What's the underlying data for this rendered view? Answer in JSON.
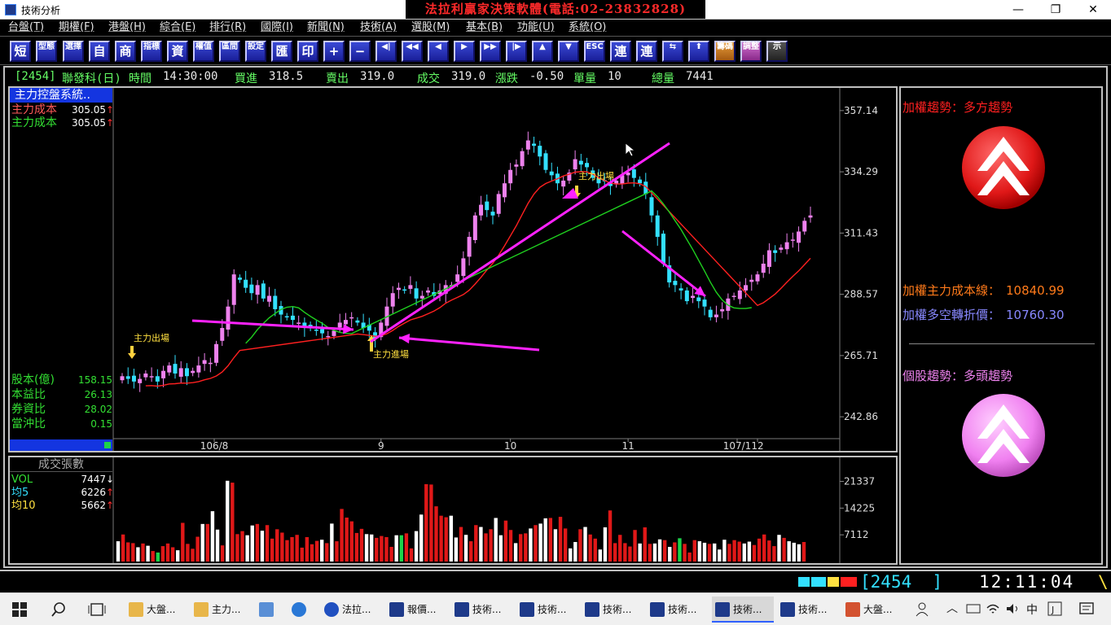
{
  "window": {
    "title": "技術分析",
    "banner": "法拉利贏家決策軟體(電話:02-23832828)",
    "minimize": "—",
    "restore": "❐",
    "close": "✕"
  },
  "menu": [
    "台盤(T)",
    "期權(F)",
    "港盤(H)",
    "綜合(E)",
    "排行(R)",
    "國際(I)",
    "新聞(N)",
    "技術(A)",
    "選股(M)",
    "基本(B)",
    "功能(U)",
    "系統(O)"
  ],
  "toolbar": [
    "短",
    "型態",
    "選擇",
    "自",
    "商",
    "指標",
    "資",
    "權值",
    "區間",
    "設定",
    "匯",
    "印",
    "+",
    "−",
    "◀|",
    "◀◀",
    "◀",
    "▶",
    "▶▶",
    "|▶",
    "▲",
    "▼",
    "ESC",
    "連",
    "連",
    "⇆",
    "⬆",
    "籌碼",
    "調整",
    "示"
  ],
  "quote": {
    "code": "[2454]",
    "name": "聯發科(日)",
    "time_label": "時間",
    "time": "14:30:00",
    "bid_label": "買進",
    "bid": "318.5",
    "ask_label": "賣出",
    "ask": "319.0",
    "deal_label": "成交",
    "deal": "319.0",
    "chg_label": "漲跌",
    "chg": "-0.50",
    "vol_label": "單量",
    "vol": "10",
    "total_label": "總量",
    "total": "7441"
  },
  "left_panel": {
    "system_button": "主力控盤系統..",
    "cost1_label": "主力成本",
    "cost1": "305.05",
    "cost2_label": "主力成本",
    "cost2": "305.05",
    "arrow": "↑",
    "fundamentals": [
      {
        "label": "股本(億)",
        "value": "158.15"
      },
      {
        "label": "本益比",
        "value": "26.13"
      },
      {
        "label": "券資比",
        "value": "28.02"
      },
      {
        "label": "當沖比",
        "value": "0.15"
      }
    ]
  },
  "vol_panel": {
    "title": "成交張數",
    "rows": [
      {
        "label": "VOL",
        "value": "7447",
        "arrow": "↓"
      },
      {
        "label": "均5",
        "value": "6226",
        "arrow": "↑"
      },
      {
        "label": "均10",
        "value": "5662",
        "arrow": "↑"
      }
    ]
  },
  "annotations": {
    "exit1": "主力出場",
    "entry": "主力進場",
    "exit2": "主力出場"
  },
  "right_panel": {
    "index_trend": "加權趨勢：多方趨勢",
    "cost_line_label": "加權主力成本線：",
    "cost_line_value": "10840.99",
    "pivot_label": "加權多空轉折價：",
    "pivot_value": "10760.30",
    "stock_trend": "個股趨勢：多頭趨勢"
  },
  "status": {
    "code": "[2454  ]",
    "clock": "12:11:04",
    "spinner": "\\"
  },
  "taskbar": [
    {
      "label": "大盤...",
      "icon": "folder-icon"
    },
    {
      "label": "主力...",
      "icon": "folder-icon"
    },
    {
      "label": "",
      "icon": "computer-icon"
    },
    {
      "label": "",
      "icon": "ie-icon"
    },
    {
      "label": "法拉...",
      "icon": "app-icon"
    },
    {
      "label": "報價...",
      "icon": "chart-app-icon"
    },
    {
      "label": "技術...",
      "icon": "chart-app-icon"
    },
    {
      "label": "技術...",
      "icon": "chart-app-icon"
    },
    {
      "label": "技術...",
      "icon": "chart-app-icon"
    },
    {
      "label": "技術...",
      "icon": "chart-app-icon"
    },
    {
      "label": "技術...",
      "icon": "chart-app-icon"
    },
    {
      "label": "技術...",
      "icon": "chart-app-icon"
    },
    {
      "label": "大盤...",
      "icon": "powerpoint-icon"
    }
  ],
  "tray": {
    "ime": "中"
  },
  "chart_data": [
    {
      "type": "candlestick",
      "title": "",
      "ylabel": "",
      "ylim": [
        235,
        365
      ],
      "y_ticks": [
        357.14,
        334.29,
        311.43,
        288.57,
        265.71,
        242.86
      ],
      "x_ticks": [
        "106/8",
        "9",
        "10",
        "11",
        "12",
        "107/1"
      ],
      "colors": {
        "up": "#ee82ee",
        "down": "#33e0ff",
        "cost_line_red": "#ff2020",
        "cost_line_green": "#1fd11f",
        "annotation_arrow": "#ff22ff"
      },
      "close_series": [
        258,
        257,
        256,
        257,
        259,
        258,
        256,
        260,
        262,
        259,
        261,
        258,
        260,
        262,
        264,
        263,
        270,
        276,
        284,
        296,
        294,
        291,
        289,
        292,
        287,
        288,
        283,
        281,
        280,
        279,
        278,
        276,
        276,
        275,
        274,
        273,
        275,
        278,
        279,
        280,
        278,
        276,
        275,
        272,
        278,
        284,
        289,
        291,
        290,
        292,
        287,
        288,
        290,
        288,
        290,
        292,
        292,
        296,
        302,
        310,
        318,
        322,
        320,
        318,
        326,
        330,
        335,
        337,
        342,
        346,
        344,
        340,
        335,
        333,
        330,
        331,
        334,
        339,
        337,
        336,
        332,
        330,
        331,
        329,
        331,
        333,
        334,
        332,
        330,
        326,
        318,
        310,
        300,
        293,
        292,
        290,
        286,
        288,
        286,
        284,
        280,
        281,
        283,
        287,
        288,
        290,
        292,
        294,
        296,
        300,
        305,
        304,
        306,
        308,
        309,
        312,
        316,
        318
      ]
    },
    {
      "type": "bar",
      "title": "成交張數",
      "y_ticks": [
        21337,
        14225,
        7112
      ],
      "ylim": [
        0,
        26000
      ],
      "values": [
        5400,
        7200,
        5100,
        4900,
        3800,
        4800,
        4200,
        2800,
        2400,
        4100,
        4800,
        3800,
        3000,
        10300,
        4700,
        3400,
        6600,
        10000,
        10000,
        13400,
        8500,
        4300,
        21500,
        21000,
        7300,
        8100,
        7000,
        9600,
        10000,
        8200,
        9700,
        6100,
        8600,
        7700,
        5700,
        6500,
        7100,
        3700,
        6500,
        4600,
        5500,
        5800,
        4900,
        10100,
        5400,
        14000,
        11700,
        10700,
        7600,
        8700,
        7300,
        7200,
        6300,
        6800,
        6500,
        3900,
        7000,
        7000,
        7500,
        3500,
        8100,
        12500,
        20600,
        20500,
        14700,
        12200,
        11800,
        12200,
        6400,
        9200,
        7100,
        5400,
        9700,
        9200,
        7500,
        8600,
        11600,
        7000,
        10900,
        8400,
        4900,
        7300,
        7500,
        8800,
        9700,
        10100,
        11500,
        11600,
        8600,
        11900,
        8800,
        3500,
        5200,
        8600,
        9200,
        7200,
        6100,
        3200,
        9100,
        13600,
        4900,
        7100,
        4900,
        4000,
        8400,
        4800,
        9100,
        4700,
        4800,
        5900,
        5700,
        3900,
        5100,
        6200,
        4700,
        2400,
        5700,
        5400,
        5000,
        4700,
        4800,
        3200,
        5800,
        4700,
        5700,
        5300,
        4800,
        5300,
        4400,
        6100,
        7200,
        5600,
        4100,
        7100,
        6300,
        5400,
        5000,
        4600,
        5200
      ]
    }
  ]
}
